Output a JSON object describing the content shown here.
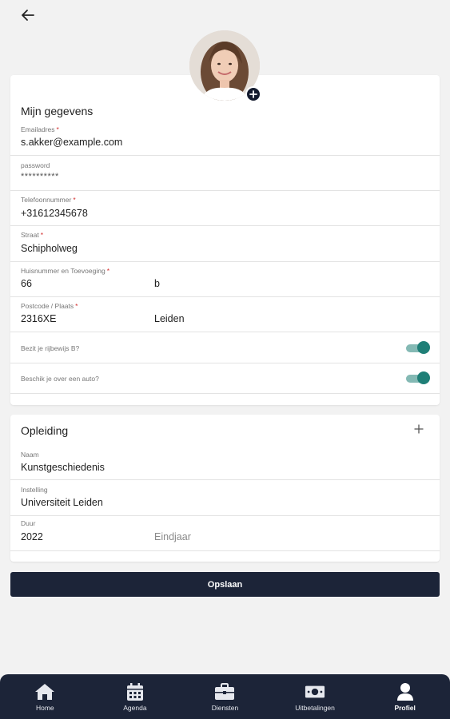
{
  "header": {
    "back_icon": "arrow-left-icon"
  },
  "profile": {
    "add_photo_icon": "plus-icon"
  },
  "personal": {
    "title": "Mijn gegevens",
    "email": {
      "label": "Emailadres",
      "required": "*",
      "value": "s.akker@example.com"
    },
    "password": {
      "label": "password",
      "value": "**********"
    },
    "phone": {
      "label": "Telefoonnummer",
      "required": "*",
      "value": "+31612345678"
    },
    "street": {
      "label": "Straat",
      "required": "*",
      "value": "Schipholweg"
    },
    "house": {
      "label": "Huisnummer en Toevoeging",
      "required": "*",
      "number": "66",
      "suffix": "b"
    },
    "postal": {
      "label": "Postcode / Plaats",
      "required": "*",
      "code": "2316XE",
      "city": "Leiden"
    },
    "license": {
      "label": "Bezit je rijbewijs B?",
      "enabled": true
    },
    "car": {
      "label": "Beschik je over een auto?",
      "enabled": true
    },
    "accent_color": "#1f7f77"
  },
  "education": {
    "title": "Opleiding",
    "add_icon": "plus-icon",
    "name": {
      "label": "Naam",
      "value": "Kunstgeschiedenis"
    },
    "institution": {
      "label": "Instelling",
      "value": "Universiteit Leiden"
    },
    "period": {
      "label": "Duur",
      "start": "2022",
      "end_placeholder": "Eindjaar"
    }
  },
  "save_label": "Opslaan",
  "nav": {
    "items": [
      {
        "label": "Home",
        "icon": "home-icon",
        "active": false
      },
      {
        "label": "Agenda",
        "icon": "calendar-icon",
        "active": false
      },
      {
        "label": "Diensten",
        "icon": "briefcase-icon",
        "active": false
      },
      {
        "label": "Uitbetalingen",
        "icon": "money-icon",
        "active": false
      },
      {
        "label": "Profiel",
        "icon": "user-icon",
        "active": true
      }
    ],
    "background": "#1c2438"
  }
}
